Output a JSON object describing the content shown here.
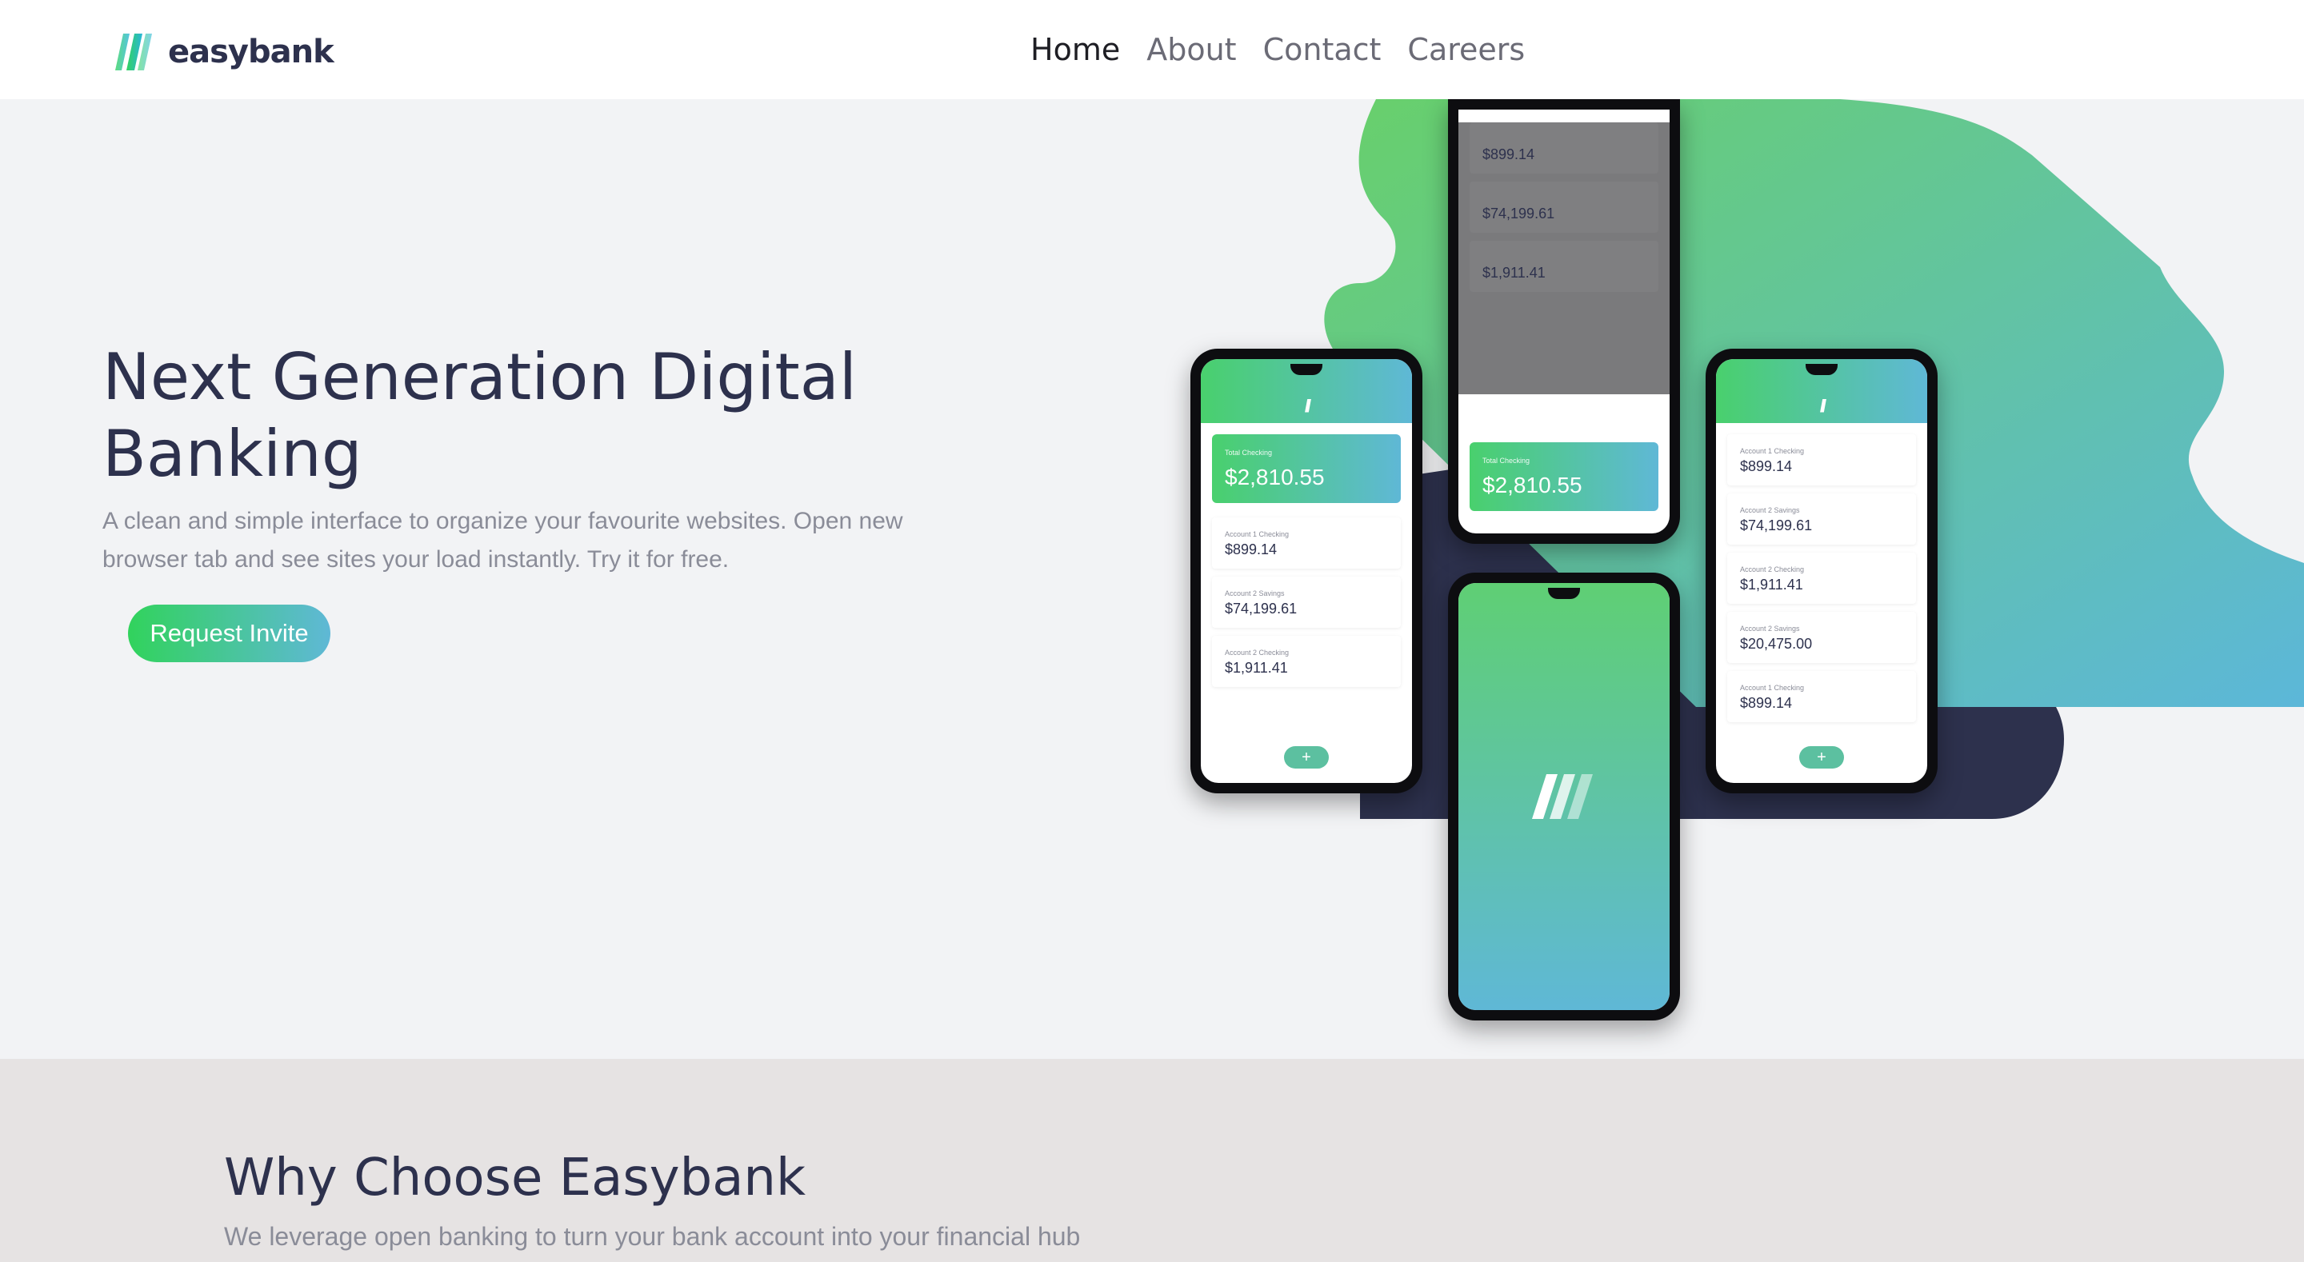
{
  "header": {
    "logo_text": "easybank",
    "nav": [
      "Home",
      "About",
      "Contact",
      "Careers"
    ],
    "active_nav": "Home"
  },
  "hero": {
    "title": "Next Generation Digital Banking",
    "description": "A clean and simple interface to organize your favourite websites. Open new browser tab and see sites your load instantly. Try it for free.",
    "cta_label": "Request Invite"
  },
  "phones": {
    "total_label": "Total Checking",
    "total_amount": "$2,810.55",
    "accounts": [
      {
        "label": "Account 1 Checking",
        "amount": "$899.14"
      },
      {
        "label": "Account 2 Savings",
        "amount": "$74,199.61"
      },
      {
        "label": "Account 2 Checking",
        "amount": "$1,911.41"
      },
      {
        "label": "Account 2 Savings",
        "amount": "$20,475.00"
      },
      {
        "label": "Account 1 Checking",
        "amount": "$899.14"
      }
    ]
  },
  "why": {
    "title": "Why Choose Easybank",
    "subtitle": "We leverage open banking to turn your bank account into your financial hub"
  },
  "colors": {
    "brand_dark": "#2d314d",
    "lime_green": "#31d35c",
    "bright_cyan": "#5fb8d6",
    "hero_bg": "#f2f3f5",
    "section_bg": "#e6e3e3"
  }
}
